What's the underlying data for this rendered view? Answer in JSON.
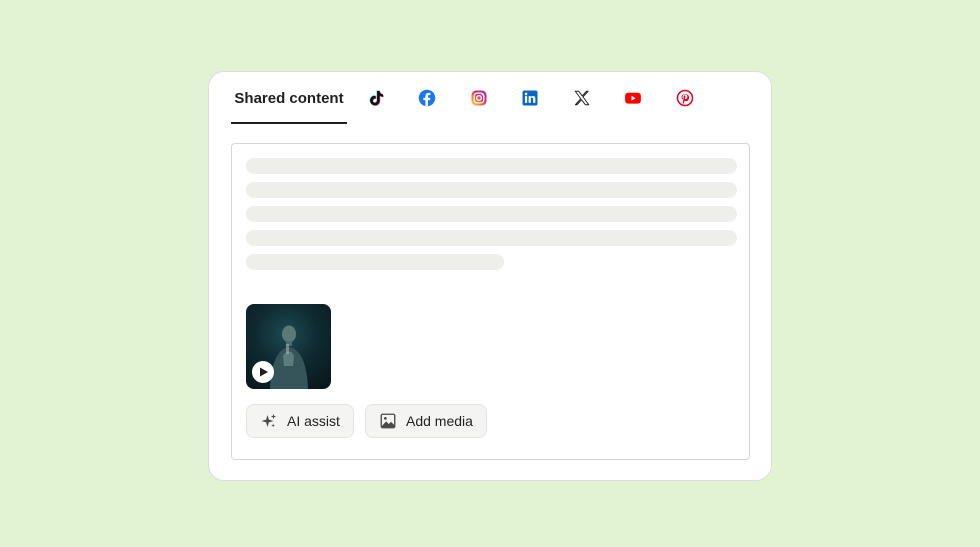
{
  "tabs": {
    "shared_label": "Shared content",
    "networks": [
      "tiktok",
      "facebook",
      "instagram",
      "linkedin",
      "x",
      "youtube",
      "pinterest"
    ]
  },
  "colors": {
    "background": "#e2f3d1",
    "facebook": "#1877f2",
    "linkedin": "#0a66c2",
    "youtube": "#ff0000",
    "pinterest": "#e60023",
    "skeleton": "#eeeeea"
  },
  "editor": {
    "media": {
      "type": "video",
      "icon": "play-icon"
    },
    "actions": {
      "ai_assist_label": "AI assist",
      "ai_assist_icon": "sparkle-icon",
      "add_media_label": "Add media",
      "add_media_icon": "image-icon"
    }
  }
}
